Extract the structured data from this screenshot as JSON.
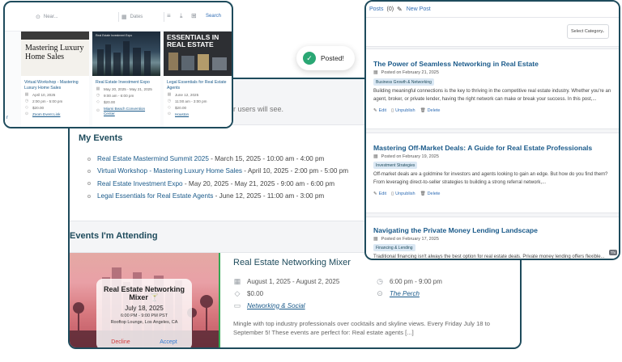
{
  "events_panel": {
    "partial_text": "r users will see.",
    "my_events_title": "My Events",
    "my_events": [
      {
        "name": "Real Estate Mastermind Summit 2025",
        "when": " - March 15, 2025 - 10:00 am - 4:00 pm"
      },
      {
        "name": "Virtual Workshop - Mastering Luxury Home Sales",
        "when": " - April 10, 2025 - 2:00 pm - 5:00 pm"
      },
      {
        "name": "Real Estate Investment Expo",
        "when": " - May 20, 2025 - May 21, 2025 - 9:00 am - 6:00 pm"
      },
      {
        "name": "Legal Essentials for Real Estate Agents",
        "when": " - June 12, 2025 - 11:00 am - 3:00 pm"
      }
    ],
    "attending_title": "Events I'm Attending",
    "attending": {
      "invite_title": "Real Estate Networking Mixer 🍸",
      "invite_date": "July 18, 2025",
      "invite_time": "6:00 PM - 9:00 PM PST",
      "invite_place": "Rooftop Lounge, Los Angeles, CA",
      "decline_label": "Decline",
      "accept_label": "Accept",
      "title": "Real Estate Networking Mixer",
      "dates": "August 1, 2025 - August 2, 2025",
      "time": "6:00 pm - 9:00 pm",
      "price": "$0.00",
      "venue": "The Perch",
      "category": "Networking & Social",
      "description": "Mingle with top industry professionals over cocktails and skyline views. Every Friday July 18 to September 5! These events are perfect for: Real estate agents [...]"
    }
  },
  "search_panel": {
    "near_placeholder": "Near...",
    "dates_placeholder": "Dates",
    "search_label": "Search",
    "partial_left": "r",
    "cards": [
      {
        "thumb_text": "Mastering Luxury Home Sales",
        "title": "Virtual Workshop - Mastering Luxury Home Sales",
        "date": "April 10, 2025",
        "time": "2:00 pm - 5:00 pm",
        "price": "$20.00",
        "link": "Zoom Event Link"
      },
      {
        "thumb_text": "Real Estate Investment Expo",
        "title": "Real Estate Investment Expo",
        "date": "May 20, 2025 - May 21, 2025",
        "time": "9:00 am - 6:00 pm",
        "price": "$20.00",
        "link": "Miami Beach Convention Center"
      },
      {
        "thumb_text": "ESSENTIALS IN REAL ESTATE",
        "title": "Legal Essentials for Real Estate Agents",
        "date": "June 12, 2025",
        "time": "11:00 am - 3:00 pm",
        "price": "$20.00",
        "link": "Houston"
      }
    ]
  },
  "toast": {
    "label": "Posted!"
  },
  "posts_panel": {
    "tab_label": "Posts",
    "tab_count": "(0)",
    "new_post_label": "New Post",
    "category_select": "Select Category",
    "posts": [
      {
        "title": "The Power of Seamless Networking in Real Estate",
        "date": "Posted on February 21, 2025",
        "tag": "Business Growth & Networking",
        "excerpt": "Building meaningful connections is the key to thriving in the competitive real estate industry. Whether you're an agent, broker, or private lender, having the right network can make or break your success. In this post,...",
        "edit": "Edit",
        "unpublish": "Unpublish",
        "delete": "Delete"
      },
      {
        "title": "Mastering Off-Market Deals: A Guide for Real Estate Professionals",
        "date": "Posted on February 19, 2025",
        "tag": "Investment Strategies",
        "excerpt": "Off-market deals are a goldmine for investors and agents looking to gain an edge. But how do you find them? From leveraging direct-to-seller strategies to building a strong referral network,...",
        "edit": "Edit",
        "unpublish": "Unpublish",
        "delete": "Delete"
      },
      {
        "title": "Navigating the Private Money Lending Landscape",
        "date": "Posted on February 17, 2025",
        "tag": "Financing & Lending",
        "excerpt": "Traditional financing isn't always the best option for real estate deals. Private money lending offers flexible..."
      }
    ],
    "corner_badge": "Thi"
  },
  "colors": {
    "panel_border": "#1e4b5c",
    "link": "#1a5a8a",
    "accent_blue": "#2f6db5",
    "success": "#2aa774",
    "decline": "#d23c3c"
  }
}
